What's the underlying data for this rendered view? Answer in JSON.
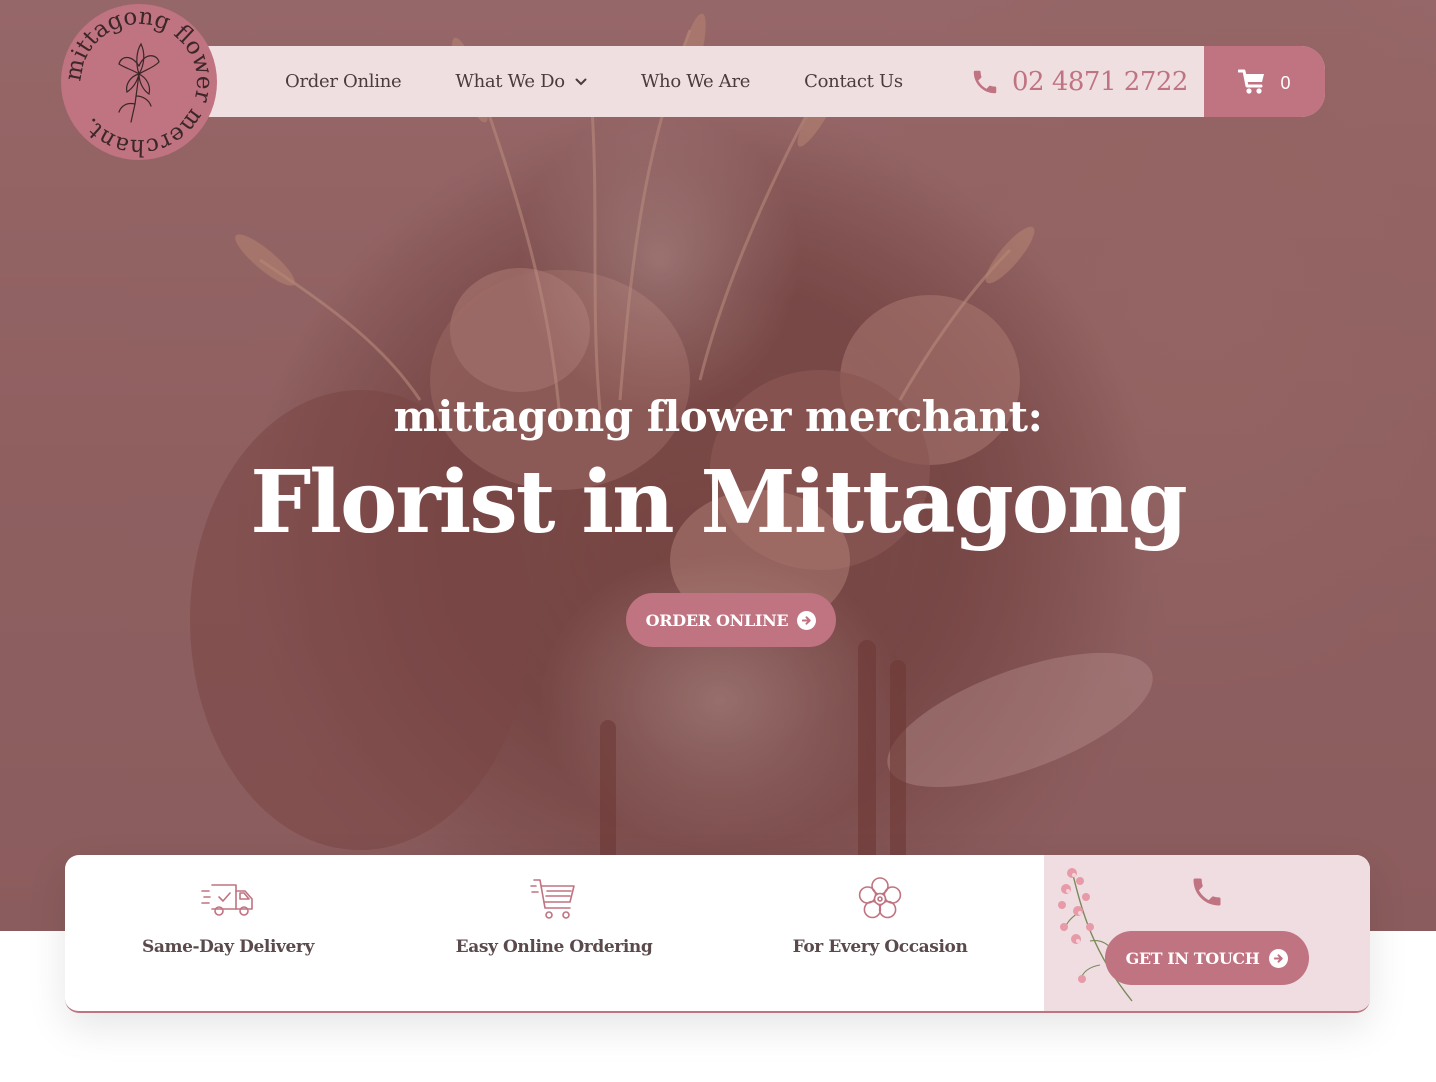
{
  "brand": {
    "logo_text": "mittagong flower merchant.",
    "logo_icon": "magnolia-line-art-icon"
  },
  "nav": {
    "items": [
      {
        "label": "Order Online",
        "has_dropdown": false
      },
      {
        "label": "What We Do",
        "has_dropdown": true
      },
      {
        "label": "Who We Are",
        "has_dropdown": false
      },
      {
        "label": "Contact Us",
        "has_dropdown": false
      }
    ],
    "phone": "02 4871 2722",
    "phone_icon": "phone-icon",
    "cart_icon": "shopping-cart-icon",
    "cart_count": "0"
  },
  "hero": {
    "subtitle": "mittagong flower merchant:",
    "title": "Florist in Mittagong",
    "cta_label": "ORDER ONLINE",
    "cta_icon": "arrow-circle-right-icon"
  },
  "features": [
    {
      "label": "Same-Day Delivery",
      "icon": "delivery-truck-icon"
    },
    {
      "label": "Easy Online Ordering",
      "icon": "shopping-cart-icon"
    },
    {
      "label": "For Every Occasion",
      "icon": "flower-icon"
    }
  ],
  "contact": {
    "icon": "phone-icon",
    "cta_label": "GET IN TOUCH",
    "cta_icon": "arrow-circle-right-icon",
    "decor_icon": "floral-sprig-icon"
  },
  "colors": {
    "accent": "#c07381",
    "nav_bg": "#f0dfe1",
    "panel_bg": "#efdde1",
    "hero_tint": "#946566",
    "nav_text": "#4a3b3c"
  }
}
